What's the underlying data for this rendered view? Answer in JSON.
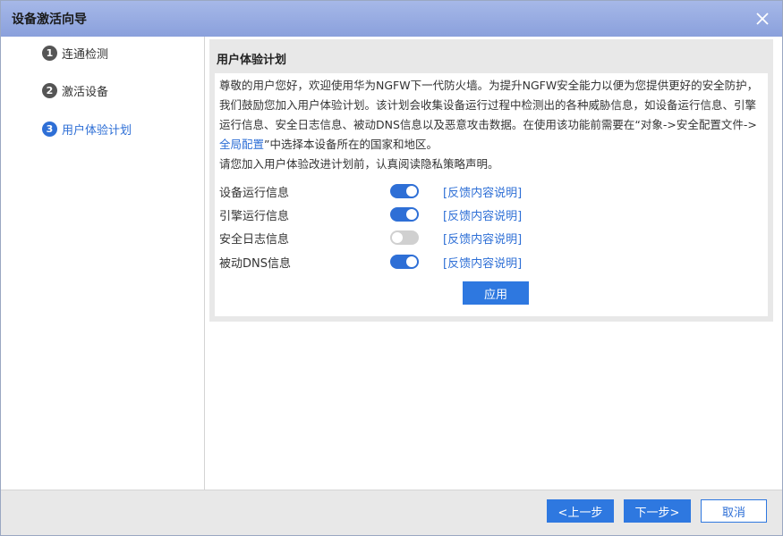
{
  "window": {
    "title": "设备激活向导"
  },
  "sidebar": {
    "steps": [
      {
        "num": "1",
        "label": "连通检测"
      },
      {
        "num": "2",
        "label": "激活设备"
      },
      {
        "num": "3",
        "label": "用户体验计划"
      }
    ],
    "active_step": 3
  },
  "panel": {
    "title": "用户体验计划",
    "intro_part1": "尊敬的用户您好，欢迎使用华为NGFW下一代防火墙。为提升NGFW安全能力以便为您提供更好的安全防护，我们鼓励您加入用户体验计划。该计划会收集设备运行过程中检测出的各种威胁信息，如设备运行信息、引擎运行信息、安全日志信息、被动DNS信息以及恶意攻击数据。在使用该功能前需要在“对象->安全配置文件->",
    "intro_link": "全局配置",
    "intro_part2": "”中选择本设备所在的国家和地区。",
    "intro_line2": "请您加入用户体验改进计划前，认真阅读隐私策略声明。",
    "options": [
      {
        "label": "设备运行信息",
        "enabled": true,
        "link": "[反馈内容说明]"
      },
      {
        "label": "引擎运行信息",
        "enabled": true,
        "link": "[反馈内容说明]"
      },
      {
        "label": "安全日志信息",
        "enabled": false,
        "link": "[反馈内容说明]"
      },
      {
        "label": "被动DNS信息",
        "enabled": true,
        "link": "[反馈内容说明]"
      }
    ],
    "apply_label": "应用"
  },
  "footer": {
    "prev_label": "<上一步",
    "next_label": "下一步>",
    "cancel_label": "取消"
  },
  "colors": {
    "accent": "#2e78e0",
    "link": "#2e6fd6",
    "titlebar": "#8aa0dc"
  }
}
